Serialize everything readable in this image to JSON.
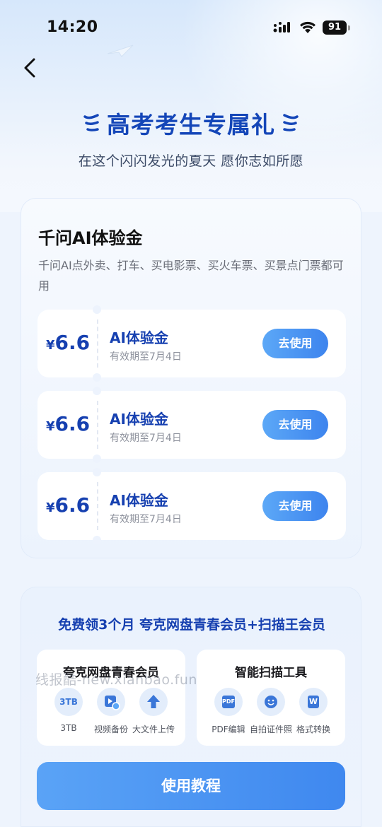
{
  "status_bar": {
    "time": "14:20",
    "battery": "91"
  },
  "hero": {
    "title": "高考考生专属礼",
    "subtitle": "在这个闪闪发光的夏天 愿你志如所愿"
  },
  "voucher_card": {
    "title": "千问AI体验金",
    "description": "千问AI点外卖、打车、买电影票、买火车票、买景点门票都可用",
    "coupons": [
      {
        "currency": "¥",
        "amount": "6.6",
        "name": "AI体验金",
        "validity": "有效期至7月4日",
        "button": "去使用"
      },
      {
        "currency": "¥",
        "amount": "6.6",
        "name": "AI体验金",
        "validity": "有效期至7月4日",
        "button": "去使用"
      },
      {
        "currency": "¥",
        "amount": "6.6",
        "name": "AI体验金",
        "validity": "有效期至7月4日",
        "button": "去使用"
      }
    ]
  },
  "membership_card": {
    "title": "免费领3个月 夸克网盘青春会员+扫描王会员",
    "boxes": [
      {
        "title": "夸克网盘青春会员",
        "features": [
          {
            "icon": "storage-3tb-icon",
            "icon_text": "3TB",
            "label": "3TB"
          },
          {
            "icon": "video-backup-icon",
            "label": "视频备份"
          },
          {
            "icon": "upload-icon",
            "label": "大文件上传"
          }
        ]
      },
      {
        "title": "智能扫描工具",
        "features": [
          {
            "icon": "pdf-edit-icon",
            "icon_text": "PDF",
            "label": "PDF编辑"
          },
          {
            "icon": "id-photo-icon",
            "label": "自拍证件照"
          },
          {
            "icon": "word-convert-icon",
            "icon_text": "W",
            "label": "格式转换"
          }
        ]
      }
    ],
    "tutorial_button": "使用教程"
  },
  "watermark": "线报酷-new.xianbao.fun",
  "colors": {
    "brand_blue": "#1640b0",
    "button_blue": "#3d84ee",
    "icon_bg": "#e3edfb"
  }
}
